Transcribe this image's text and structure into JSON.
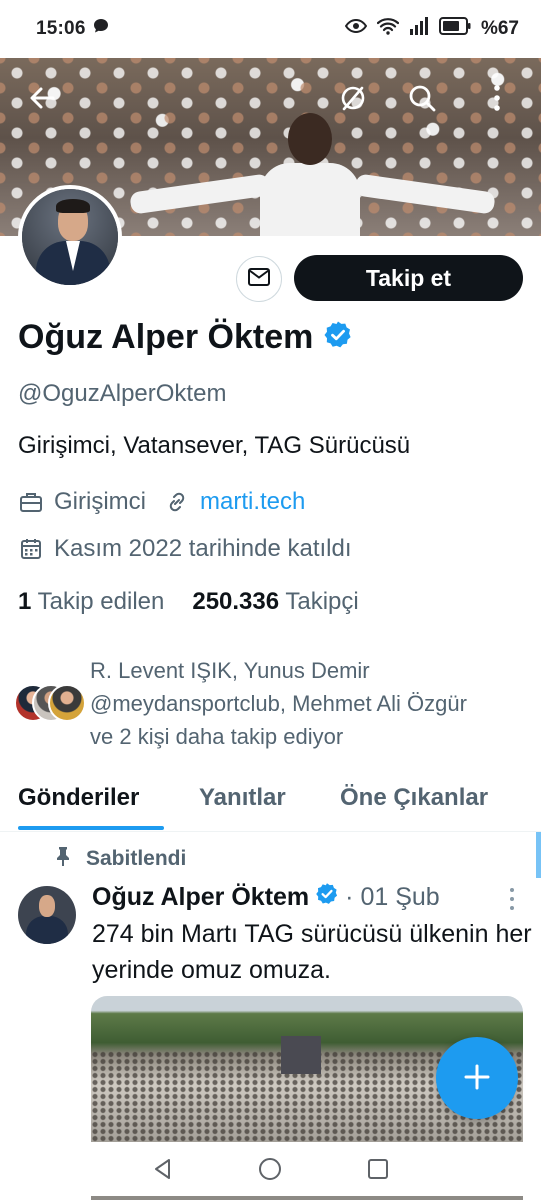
{
  "status_bar": {
    "time": "15:06",
    "battery": "%67"
  },
  "profile": {
    "name": "Oğuz Alper Öktem",
    "handle": "@OguzAlperOktem",
    "bio": "Girişimci, Vatansever, TAG Sürücüsü",
    "occupation": "Girişimci",
    "website": "marti.tech",
    "joined": "Kasım 2022 tarihinde katıldı",
    "following_count": "1",
    "following_label": "Takip edilen",
    "followers_count": "250.336",
    "followers_label": "Takipçi",
    "followers_you_know": "R. Levent IŞIK, Yunus Demir @meydansportclub, Mehmet Ali Özgür ve 2 kişi daha takip ediyor",
    "follow_button": "Takip et"
  },
  "tabs": [
    "Gönderiler",
    "Yanıtlar",
    "Öne Çıkanlar"
  ],
  "pinned_post": {
    "pinned_label": "Sabitlendi",
    "author": "Oğuz Alper Öktem",
    "date": "· 01 Şub",
    "text": "274 bin Martı TAG sürücüsü ülkenin her yerinde omuz omuza."
  },
  "colors": {
    "accent": "#1d9bf0",
    "follow_button": "#0f1419",
    "secondary_text": "#536471"
  },
  "icons": [
    "back-arrow-icon",
    "mute-icon",
    "search-icon",
    "more-vert-icon",
    "mail-icon",
    "verified-badge-icon",
    "briefcase-icon",
    "link-icon",
    "calendar-icon",
    "pin-icon",
    "compose-plus-icon"
  ]
}
